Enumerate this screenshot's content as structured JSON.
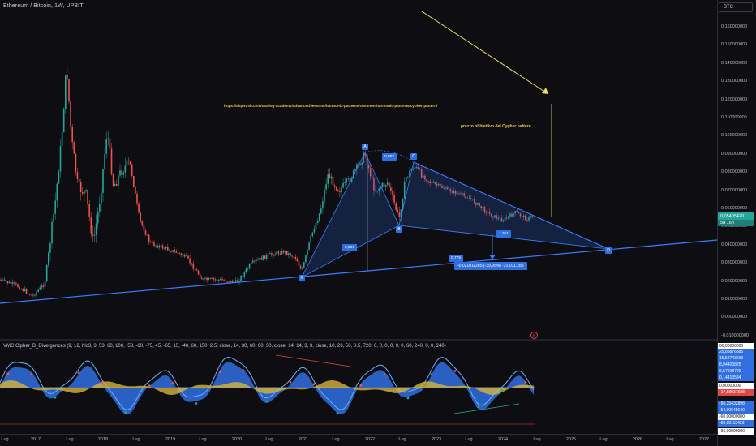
{
  "header": {
    "title": "Ethereum / Bitcoin, 1W, UPBIT",
    "currency_button": "BTC"
  },
  "price_axis": {
    "ticks": [
      "0,160000000",
      "0,150000000",
      "0,140000000",
      "0,130000000",
      "0,120000000",
      "0,110000000",
      "0,100000000",
      "0,090000000",
      "0,080000000",
      "0,070000000",
      "0,060000000",
      "0,050000000",
      "0,040000000",
      "0,030000000",
      "0,020000000",
      "0,010000000",
      "0,000000000",
      "-0,010000000"
    ],
    "current_price": "0,05405420",
    "countdown": "5d 16h",
    "current_price_color": "#26a69a"
  },
  "time_axis": {
    "ticks": [
      "Lug",
      "2017",
      "Lug",
      "2018",
      "Lug",
      "2019",
      "Lug",
      "2020",
      "Lug",
      "2021",
      "Lug",
      "2022",
      "Lug",
      "2023",
      "Lug",
      "2024",
      "Lug",
      "2025",
      "Lug",
      "2026",
      "Lug",
      "2027"
    ]
  },
  "annotations": {
    "link": "https://alqorush.com/trading-academy/advanced-lessons/harmonic-patterns/common-harmonic-patterns/cypher-pattern/",
    "target_note": "prezzo obbiettivo del Cypher pattern",
    "points": {
      "x": "X",
      "a": "A",
      "b": "B",
      "c": "C",
      "d": "D"
    },
    "ratios": {
      "xb": "0,596",
      "ac": "0,857",
      "cd": "1,351",
      "xd": "0,775"
    },
    "measurement": "-0,021011285 (-39,95%) -21.011.285"
  },
  "oscillator": {
    "title": "VMC Cipher_B_Divergences (9, 12, hlc3, 3, 53, 60, 100, -53, -60, -75, 45, -65, 15, -40, 60, 150, 2.5, close, 14, 30, 60, 60, 30, close, 14, 14, 3, 3, close, 10, 23, 50, 0.5, 720, 0, 0, 0, 0, 0, 0, 60, 240, 0, 0, 240)",
    "tags": [
      {
        "text": "60,00000000",
        "bg": "#ffffff",
        "fg": "#111111"
      },
      {
        "text": "25,85876685",
        "bg": "#2f6fe0",
        "fg": "#ffffff"
      },
      {
        "text": "15,52743593",
        "bg": "#2f6fe0",
        "fg": "#ffffff"
      },
      {
        "text": "8,94403825",
        "bg": "#2f6fe0",
        "fg": "#ffffff"
      },
      {
        "text": "6,57608790",
        "bg": "#2f6fe0",
        "fg": "#ffffff"
      },
      {
        "text": "0,14413534",
        "bg": "#2f6fe0",
        "fg": "#ffffff"
      },
      {
        "text": "0,00000000",
        "bg": "#ffffff",
        "fg": "#111111"
      },
      {
        "text": "-17,58037688",
        "bg": "#e04646",
        "fg": "#ffffff"
      },
      {
        "text": "-50,25432898",
        "bg": "#2f6fe0",
        "fg": "#ffffff"
      },
      {
        "text": "-54,00645640",
        "bg": "#2f6fe0",
        "fg": "#ffffff"
      },
      {
        "text": "-60,00000000",
        "bg": "#ffffff",
        "fg": "#111111"
      },
      {
        "text": "-88,88113429",
        "bg": "#2f6fe0",
        "fg": "#ffffff"
      },
      {
        "text": "-95,00000000",
        "bg": "#ffffff",
        "fg": "#111111"
      }
    ]
  },
  "colors": {
    "bull": "#26a69a",
    "bear": "#ef5350",
    "pattern": "#2f6fe0",
    "arrow": "#e8e060"
  }
}
